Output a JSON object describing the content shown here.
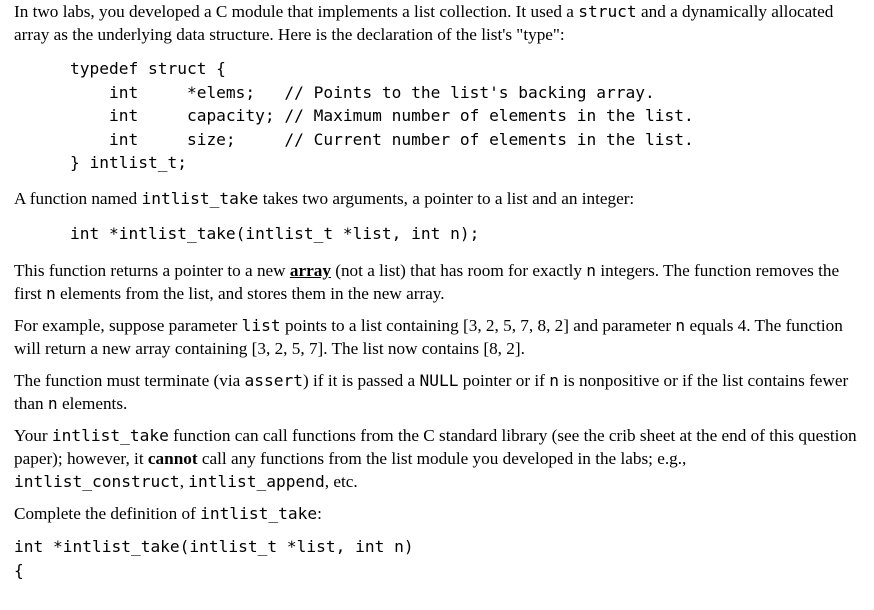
{
  "document": {
    "intro": {
      "text_part_1": "In two labs, you developed a C module that implements a list collection. It used a ",
      "code_struct": "struct",
      "text_part_2": " and a dynamically allocated array as the underlying data structure. Here is the declaration of the list's \"type\":"
    },
    "struct_code": "typedef struct {\n    int     *elems;   // Points to the list's backing array.\n    int     capacity; // Maximum number of elements in the list.\n    int     size;     // Current number of elements in the list.\n} intlist_t;",
    "function_intro": {
      "text_part_1": "A function named ",
      "code_name": "intlist_take",
      "text_part_2": " takes two arguments, a pointer to a list and an integer:"
    },
    "prototype_code": "int *intlist_take(intlist_t *list, int n);",
    "returns_para": {
      "text_part_1": "This function returns a pointer to a new ",
      "emphasis": "array",
      "text_part_2": " (not a list) that has room for exactly ",
      "code_n_1": "n",
      "text_part_3": " integers. The function removes the first ",
      "code_n_2": "n",
      "text_part_4": " elements from the list, and stores them in the new array."
    },
    "example_para": {
      "text_part_1": "For example, suppose parameter ",
      "code_list": "list",
      "text_part_2": " points to a list containing [3, 2, 5, 7, 8, 2] and parameter ",
      "code_n": "n",
      "text_part_3": " equals 4. The function will return a new array containing [3, 2, 5, 7]. The list now contains [8, 2]."
    },
    "assert_para": {
      "text_part_1": "The function must terminate (via ",
      "code_assert": "assert",
      "text_part_2": ") if it is passed a ",
      "code_null": "NULL",
      "text_part_3": " pointer or if ",
      "code_n_1": "n",
      "text_part_4": " is nonpositive or if the list contains fewer than ",
      "code_n_2": "n",
      "text_part_5": " elements."
    },
    "restriction_para": {
      "text_part_1": "Your ",
      "code_name": "intlist_take",
      "text_part_2": " function can call functions from the C standard library (see the crib sheet at the end of this question paper); however, it ",
      "emphasis_cannot": "cannot",
      "text_part_3": " call any functions from the list module you developed in the labs; e.g., ",
      "code_construct": "intlist_construct",
      "text_part_4": ", ",
      "code_append": "intlist_append",
      "text_part_5": ", etc."
    },
    "complete_para": {
      "text_part_1": "Complete the definition of ",
      "code_name": "intlist_take",
      "text_part_2": ":"
    },
    "answer_code": "int *intlist_take(intlist_t *list, int n)\n{"
  }
}
